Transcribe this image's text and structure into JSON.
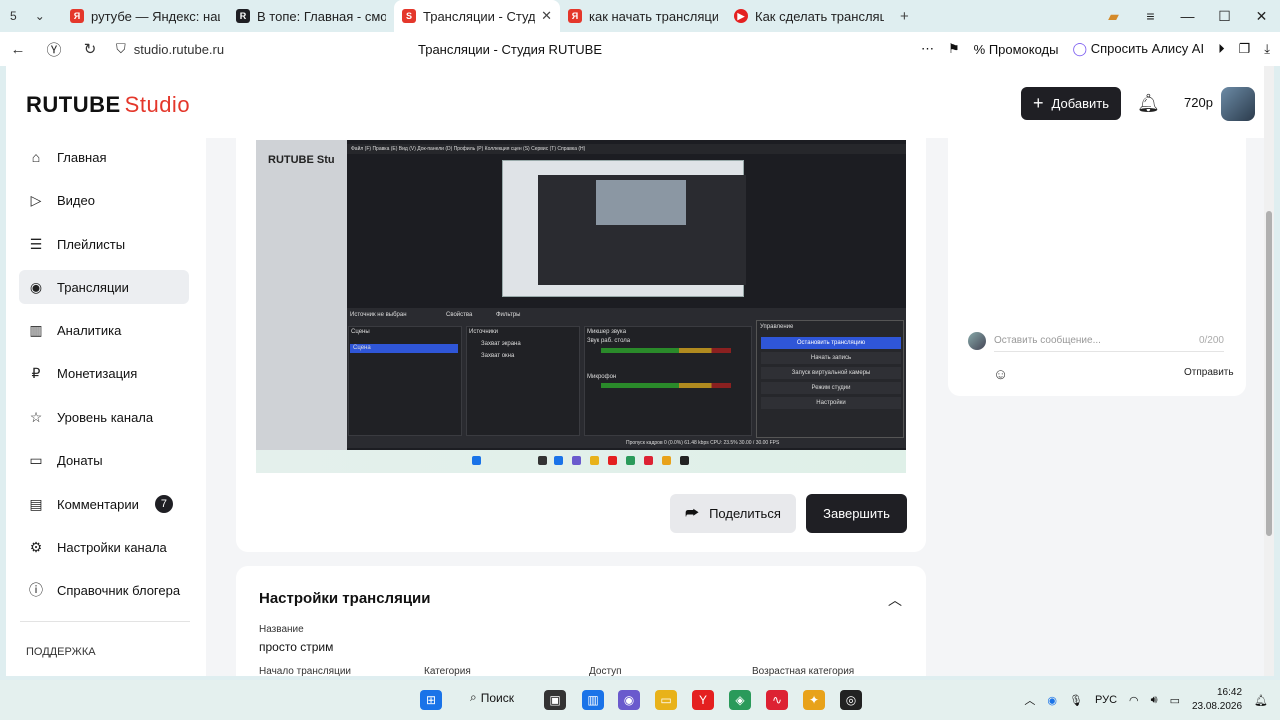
{
  "browser": {
    "tab_counter": "5",
    "tabs": [
      {
        "title": "рутубе — Яндекс: нашлось",
        "fav_color": "#e4372b",
        "fav_text": "Я"
      },
      {
        "title": "В топе: Главная - смотре",
        "fav_color": "#1f1f24",
        "fav_text": "R"
      },
      {
        "title": "Трансляции - Студия R",
        "fav_color": "#e4372b",
        "fav_text": "S",
        "active": true
      },
      {
        "title": "как начать трансляцию на",
        "fav_color": "#e4372b",
        "fav_text": "Я"
      },
      {
        "title": "Как сделать трансляцию",
        "fav_color": "#e42020",
        "fav_text": "▶"
      }
    ],
    "url": "studio.rutube.ru",
    "page_title": "Трансляции - Студия RUTUBE",
    "promo_label": "Промокоды",
    "alice_label": "Спросить Алису AI"
  },
  "header": {
    "logo_main": "RUTUBE",
    "logo_studio": "Studio",
    "add_label": "Добавить",
    "quality": "720p"
  },
  "sidebar": {
    "items": [
      {
        "label": "Главная",
        "icon": "⌂"
      },
      {
        "label": "Видео",
        "icon": "▷"
      },
      {
        "label": "Плейлисты",
        "icon": "☰"
      },
      {
        "label": "Трансляции",
        "icon": "◉"
      },
      {
        "label": "Аналитика",
        "icon": "▥"
      },
      {
        "label": "Монетизация",
        "icon": "₽"
      },
      {
        "label": "Уровень канала",
        "icon": "☆"
      },
      {
        "label": "Донаты",
        "icon": "▭"
      },
      {
        "label": "Комментарии",
        "icon": "▤"
      },
      {
        "label": "Настройки канала",
        "icon": "⚙"
      },
      {
        "label": "Справочник блогера",
        "icon": "ⓘ"
      }
    ],
    "comments_badge": "7",
    "support_label": "ПОДДЕРЖКА"
  },
  "stream": {
    "share_label": "Поделиться",
    "finish_label": "Завершить",
    "obs": {
      "logo": "RUTUBE Stu",
      "menu": "Файл (F)  Правка (E)  Вид (V)  Док-панели (D)  Профиль (P)  Коллекция сцен (S)  Сервис (T)  Справка (H)",
      "source_label": "Источник не выбран",
      "props_label": "Свойства",
      "filters_label": "Фильтры",
      "scenes_label": "Сцены",
      "scene_item": "Сцена",
      "sources_label": "Источники",
      "source1": "Захват экрана",
      "source2": "Захват окна",
      "mixer_label": "Микшер звука",
      "mixer1": "Звук раб. стола",
      "mixer2": "Микрофон",
      "ctrl_label": "Управление",
      "stop_stream": "Остановить трансляцию",
      "start_rec": "Начать запись",
      "virtual_cam": "Запуск виртуальной камеры",
      "studio_mode": "Режим студии",
      "settings": "Настройки",
      "status": "Пропуск кадров 0 (0.0%)   61.48 kbps      CPU: 23.5%   30.00 / 30.00 FPS"
    }
  },
  "chat": {
    "placeholder": "Оставить сообщение...",
    "counter": "0/200",
    "send_label": "Отправить"
  },
  "settings": {
    "title": "Настройки трансляции",
    "name_label": "Название",
    "name_value": "просто стрим",
    "fields": [
      "Начало трансляции",
      "Категория",
      "Доступ",
      "Возрастная категория"
    ]
  },
  "taskbar": {
    "search_label": "Поиск",
    "lang": "РУС",
    "time": "16:42",
    "date": "23.08.2026"
  }
}
